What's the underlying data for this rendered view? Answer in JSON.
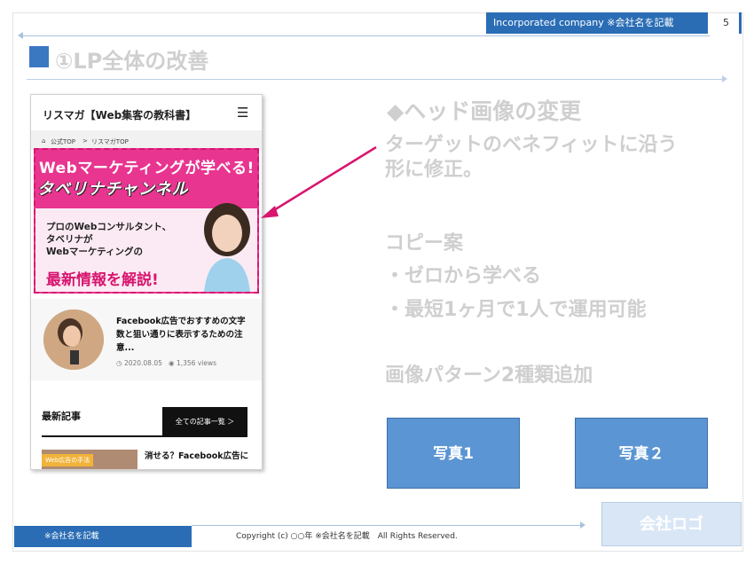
{
  "header": {
    "company": "Incorporated company ※会社名を記載",
    "page_number": "5"
  },
  "slide": {
    "title": "①LP全体の改善"
  },
  "phone": {
    "site_title": "リスマガ【Web集客の教科書】",
    "menu_icon": "hamburger-icon",
    "breadcrumb": [
      "公式TOP",
      ">",
      "リスマガTOP"
    ],
    "banner": {
      "headline": "Webマーケティングが学べる!",
      "brand": "タベリナチャンネル",
      "lead": [
        "プロのWebコンサルタント、",
        "タベリナが",
        "Webマーケティングの"
      ],
      "emphasis": "最新情報を解説!"
    },
    "featured_post": {
      "title": "Facebook広告でおすすめの文字数と狙い通りに表示するための注意...",
      "date": "2020.08.05",
      "views": "1,356 views"
    },
    "latest": {
      "heading": "最新記事",
      "button": "全ての記事一覧 ＞",
      "tag": "Web広告の手法",
      "next_title": "消せる？Facebook広告に"
    }
  },
  "right": {
    "section_heading": "◆ヘッド画像の変更",
    "description": [
      "ターゲットのベネフィットに沿う",
      "形に修正。"
    ],
    "copy_heading": "コピー案",
    "copy_items": [
      "・ゼロから学べる",
      "・最短1ヶ月で1人で運用可能"
    ],
    "image_note": "画像パターン2種類追加",
    "photo1": "写真1",
    "photo2": "写真２"
  },
  "footer": {
    "company": "※会社名を記載",
    "copyright": "Copyright (c) ○○年 ※会社名を記載　All Rights Reserved.",
    "logo": "会社ロゴ"
  },
  "colors": {
    "accent_blue": "#2a6db5",
    "banner_pink": "#e83590",
    "arrow_pink": "#d8156f",
    "photo_blue": "#5b95d3"
  }
}
